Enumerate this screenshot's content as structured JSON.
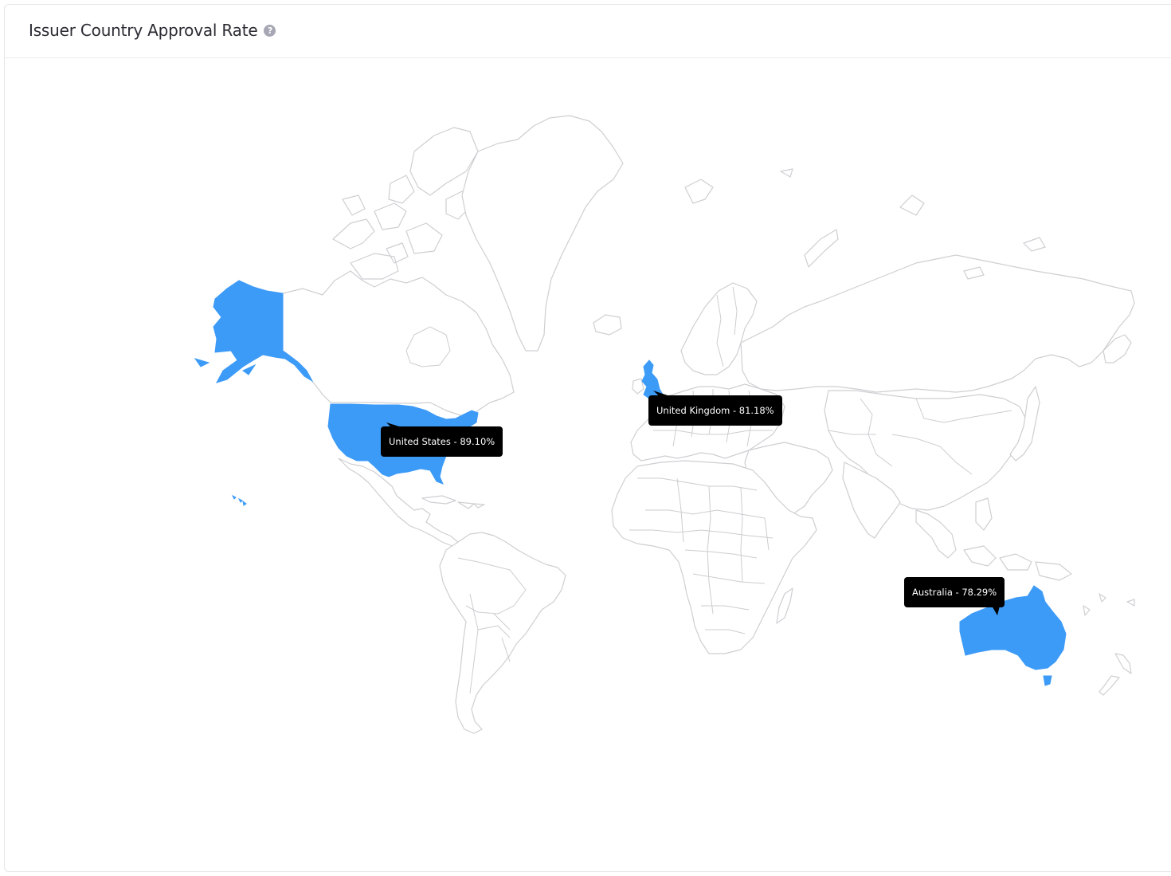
{
  "header": {
    "title": "Issuer Country Approval Rate",
    "help_icon": "question-circle-icon"
  },
  "colors": {
    "highlight": "#3d9bf8",
    "land_stroke": "#cfcfd3",
    "tooltip_bg": "#000000"
  },
  "map": {
    "highlighted_countries": [
      {
        "country": "United States",
        "approval_rate": "89.10%",
        "label": "United States - 89.10%"
      },
      {
        "country": "United Kingdom",
        "approval_rate": "81.18%",
        "label": "United Kingdom - 81.18%"
      },
      {
        "country": "Australia",
        "approval_rate": "78.29%",
        "label": "Australia - 78.29%"
      }
    ]
  }
}
